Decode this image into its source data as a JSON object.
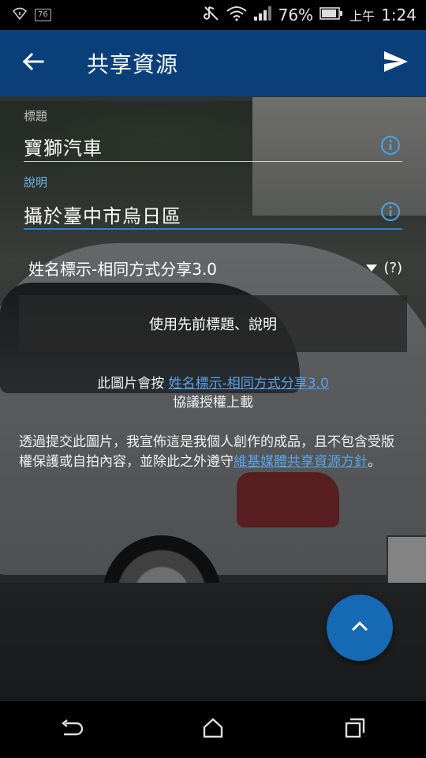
{
  "status_bar": {
    "battery_small": "76",
    "battery_percent": "76%",
    "time_prefix": "上午",
    "time": "1:24"
  },
  "app_bar": {
    "title": "共享資源"
  },
  "form": {
    "title_label": "標題",
    "title_value": "寶獅汽車",
    "description_label": "說明",
    "description_value": "攝於臺中市烏日區"
  },
  "license": {
    "selected": "姓名標示-相同方式分享3.0",
    "help": "(?)"
  },
  "use_previous_button": "使用先前標題、說明",
  "license_note": {
    "prefix": "此圖片會按 ",
    "link": "姓名標示-相同方式分享3.0",
    "suffix": "協議授權上載"
  },
  "declaration": {
    "text": "透過提交此圖片，我宣佈這是我個人創作的成品，且不包含受版權保護或自拍內容，並除此之外遵守",
    "link": "維基媒體共享資源方針",
    "end": "。"
  },
  "icons": {
    "back": "arrow-left-icon",
    "send": "send-icon",
    "info": "info-icon",
    "fab": "chevron-up-icon",
    "nav_back": "nav-back-icon",
    "nav_home": "nav-home-icon",
    "nav_recent": "nav-recent-icon"
  },
  "colors": {
    "app_bar": "#0b3f7a",
    "accent": "#2f7fc8",
    "link": "#5aa2e6",
    "fab": "#1669b3"
  }
}
